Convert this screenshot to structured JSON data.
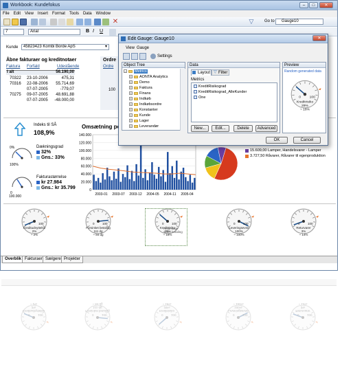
{
  "window": {
    "title": "Workbook: Kundefokus"
  },
  "menu": [
    "File",
    "Edit",
    "View",
    "Insert",
    "Format",
    "Tools",
    "Data",
    "Window"
  ],
  "toolbar": {
    "goto_label": "Go to",
    "goto_value": "Gauge10"
  },
  "format_bar": {
    "size": "7",
    "font": "Arial"
  },
  "customer": {
    "label": "Kunde",
    "value": "45823423 Kombi Borde ApS"
  },
  "invoices": {
    "title": "Åbne fakturaer og kreditnotaer",
    "headers": [
      "Faktura",
      "Forfald",
      "Udestående"
    ],
    "total_label": "I alt",
    "total_value": "56.190,00",
    "rows": [
      {
        "invoice": "70322",
        "due": "23-10-2006",
        "amount": "475,31"
      },
      {
        "invoice": "70316",
        "due": "22-08-2006",
        "amount": "55.714,69"
      },
      {
        "invoice": "",
        "due": "07-07-2005",
        "amount": "-779,07"
      },
      {
        "invoice": "70275",
        "due": "09-07-2005",
        "amount": "48.691,88"
      },
      {
        "invoice": "",
        "due": "07-07-2005",
        "amount": "-48.000,00"
      }
    ]
  },
  "orders": {
    "title": "Ordre",
    "header": "Ordre",
    "row_value": "100"
  },
  "index": {
    "label": "Indeks til SÅ",
    "value": "108,9%"
  },
  "coverage": {
    "label": "Dækningsgrad",
    "value": "32%",
    "avg": "Gns.: 33%",
    "min": "0%",
    "max": "100%"
  },
  "invoice_size": {
    "label": "Fakturastørrelse",
    "value": "kr 27.984",
    "avg": "Gns.: kr 35.799",
    "min": "0",
    "max": "100.000"
  },
  "chart_data": {
    "type": "bar",
    "title": "Omsætning per",
    "x_ticks": [
      "2003-01",
      "2003-07",
      "2003-12",
      "2004-05",
      "2004-11",
      "2005-04"
    ],
    "ylim": [
      0,
      140000
    ],
    "y_ticks": [
      "0",
      "20.000",
      "40.000",
      "60.000",
      "80.000",
      "100.000",
      "120.000",
      "140.000"
    ],
    "values": [
      38000,
      22000,
      30000,
      18000,
      42000,
      26000,
      56000,
      34000,
      24000,
      46000,
      28000,
      54000,
      20000,
      40000,
      32000,
      62000,
      27000,
      48000,
      22000,
      65000,
      36000,
      118000,
      30000,
      52000,
      24000,
      44000,
      70000,
      38000,
      28000,
      58000,
      34000,
      50000,
      20000,
      96000,
      42000,
      60000,
      30000,
      74000,
      26000,
      46000,
      56000,
      32000,
      22000,
      38000,
      18000,
      30000
    ],
    "line": [
      60000,
      55000,
      52000,
      50000,
      48000,
      45000,
      44000,
      43000,
      42000,
      40000,
      40000,
      42000,
      40000,
      38000
    ]
  },
  "pie": {
    "legend": [
      {
        "label": "15.609,00 Lamper, Handelsvarer - Lamper",
        "color": "#6a3ea1"
      },
      {
        "label": "3.727,50 Råvarer, Råvarer til egenproduktion",
        "color": "#e8742a"
      }
    ],
    "slices": [
      {
        "value": 0.52,
        "color": "#d63a1e"
      },
      {
        "value": 0.14,
        "color": "#f1c21b"
      },
      {
        "value": 0.12,
        "color": "#5aa53a"
      },
      {
        "value": 0.14,
        "color": "#2a64c5"
      },
      {
        "value": 0.08,
        "color": "#6a3ea1"
      }
    ]
  },
  "gauges": [
    {
      "label": "Kreditudnyttelse",
      "value": "2%",
      "avg": "~ 2%",
      "lo": "0",
      "hi": "100",
      "level": 0.02
    },
    {
      "label": "Forsinket betaling",
      "value": "111 dg",
      "avg": "~ 84 dg",
      "lo": "0",
      "hi": "100",
      "level": 0.86
    },
    {
      "label": "Kreditrisiko",
      "value": "29%",
      "avg": "~ 18%",
      "lo": "0",
      "hi": "100",
      "level": 0.29
    },
    {
      "label": "Leveringsevne",
      "value": "100%",
      "avg": "~ 100%",
      "lo": "0",
      "hi": "100",
      "level": 1.0
    },
    {
      "label": "Returvarer",
      "value": "3%",
      "avg": "~ 14%",
      "lo": "0",
      "hi": "100",
      "level": 0.03
    }
  ],
  "gauge_tooltip": "Antal dage siden betaling",
  "sheet_tabs": [
    "Overblik",
    "Fakturaer",
    "Sælgere",
    "Projekter"
  ],
  "dialog": {
    "title": "Edit Gauge: Gauge10",
    "menu": [
      "View",
      "Gauge"
    ],
    "settings_label": "Settings",
    "object_tree_label": "Object Tree",
    "tree_items": [
      "Metrics",
      "AONTA Analytics",
      "Demo",
      "Faktura",
      "Finans",
      "Indkøb",
      "Indkøbsordre",
      "Konstanter",
      "Kunde",
      "Lager",
      "Leverandør"
    ],
    "data_label": "Data",
    "tab_layout": "Layout",
    "tab_filter": "Filter",
    "metrics_label": "Metrics",
    "metrics": [
      "KreditRisikograd",
      "KreditRisikograd_AlleKunder",
      "One"
    ],
    "buttons": [
      "New...",
      "Edit...",
      "Delete",
      "Advanced"
    ],
    "preview_label": "Preview",
    "preview_note": "Random generated data",
    "preview_gauge": {
      "label": "Kreditrisiko",
      "value": "29%",
      "avg": "~ 18%",
      "lo": "0",
      "hi": "100",
      "level": 0.29
    },
    "ok_label": "OK",
    "cancel_label": "Cancel"
  },
  "colors": {
    "bar": "#1f4fa0",
    "accent": "#2e6db4",
    "needle": "#1a4e8a"
  }
}
